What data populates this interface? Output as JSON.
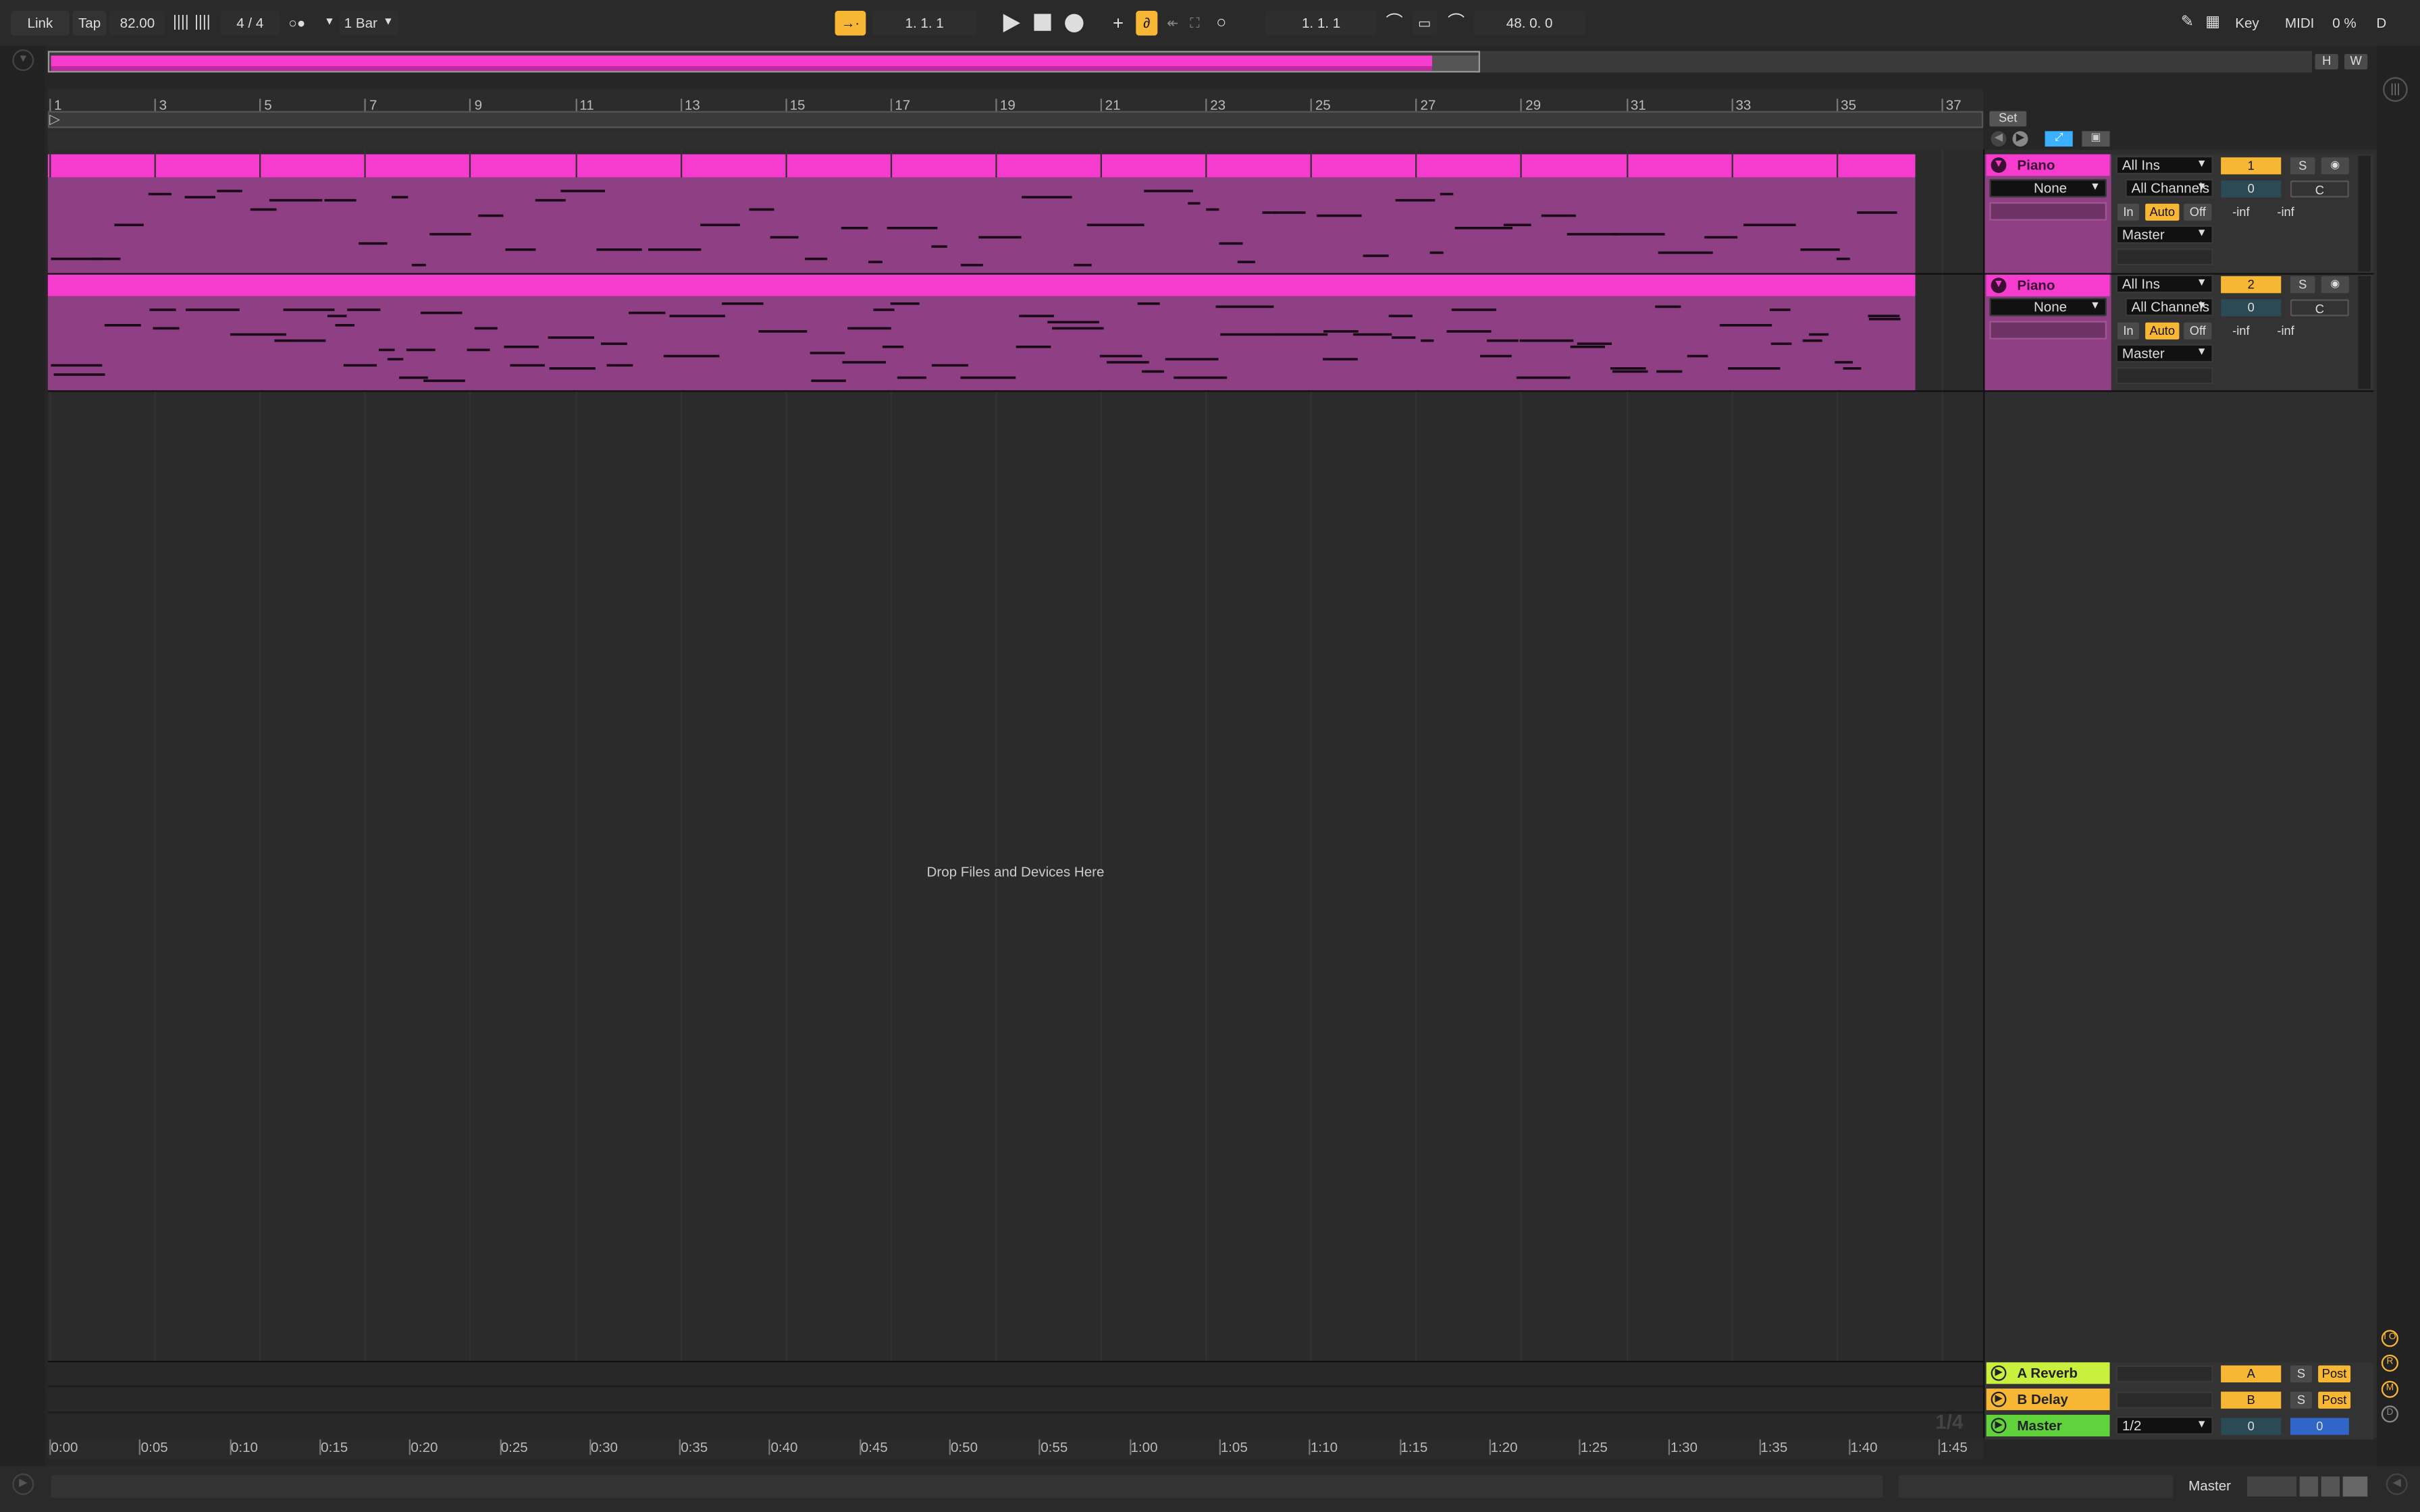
{
  "toolbar": {
    "link": "Link",
    "tap": "Tap",
    "tempo": "82.00",
    "time_signature": "4 / 4",
    "quantize": "1 Bar",
    "position": "1.   1.   1",
    "loop_start": "1.   1.   1",
    "loop_length": "48.   0.   0",
    "key": "Key",
    "midi": "MIDI",
    "cpu": "0 %",
    "d": "D"
  },
  "overview": {
    "h_btn": "H",
    "w_btn": "W"
  },
  "ruler": {
    "bars": [
      "1",
      "3",
      "5",
      "7",
      "9",
      "11",
      "13",
      "15",
      "17",
      "19",
      "21",
      "23",
      "25",
      "27",
      "29",
      "31",
      "33",
      "35",
      "37"
    ],
    "set_label": "Set"
  },
  "time_ruler": [
    "0:00",
    "0:05",
    "0:10",
    "0:15",
    "0:20",
    "0:25",
    "0:30",
    "0:35",
    "0:40",
    "0:45",
    "0:50",
    "0:55",
    "1:00",
    "1:05",
    "1:10",
    "1:15",
    "1:20",
    "1:25",
    "1:30",
    "1:35",
    "1:40",
    "1:45"
  ],
  "drop_hint": "Drop Files and Devices Here",
  "zoom_fraction": "1/4",
  "colors": {
    "clip": "#f53ccf",
    "clip_body": "#8f3f83",
    "reverb": "#c8f03c",
    "delay": "#f7b734",
    "master": "#5fd23c",
    "accent": "#f7b734",
    "blue": "#3ab0ff"
  },
  "tracks": [
    {
      "name": "Piano",
      "monitor_none": "None",
      "input": "All Ins",
      "channel": "All Channels",
      "mon_in": "In",
      "mon_auto": "Auto",
      "mon_off": "Off",
      "output": "Master",
      "number": "1",
      "solo": "S",
      "volume": "0",
      "pan": "C",
      "peak_l": "-inf",
      "peak_r": "-inf"
    },
    {
      "name": "Piano",
      "monitor_none": "None",
      "input": "All Ins",
      "channel": "All Channels",
      "mon_in": "In",
      "mon_auto": "Auto",
      "mon_off": "Off",
      "output": "Master",
      "number": "2",
      "solo": "S",
      "volume": "0",
      "pan": "C",
      "peak_l": "-inf",
      "peak_r": "-inf"
    }
  ],
  "returns": [
    {
      "name": "A Reverb",
      "letter": "A",
      "solo": "S",
      "post": "Post"
    },
    {
      "name": "B Delay",
      "letter": "B",
      "solo": "S",
      "post": "Post"
    }
  ],
  "master": {
    "name": "Master",
    "output": "1/2",
    "volume": "0",
    "pan": "0"
  },
  "side_buttons": [
    "I O",
    "R",
    "M",
    "D"
  ],
  "status": {
    "master_label": "Master"
  }
}
